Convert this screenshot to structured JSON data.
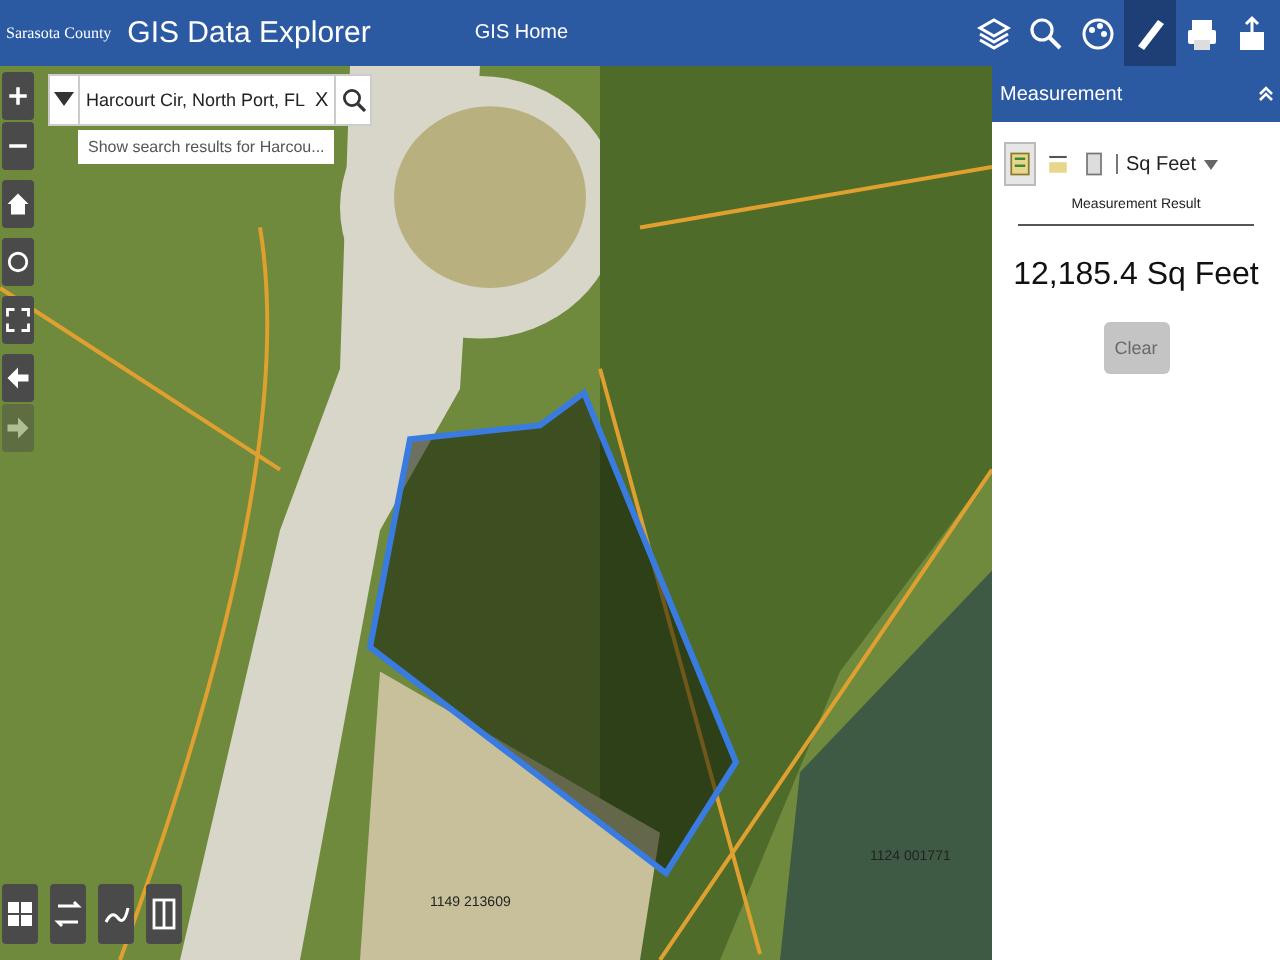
{
  "header": {
    "org": "Sarasota County",
    "title": "GIS Data Explorer",
    "nav_link": "GIS Home",
    "tools": [
      {
        "kind": "layers",
        "selected": false
      },
      {
        "kind": "search",
        "selected": false
      },
      {
        "kind": "palette",
        "selected": false
      },
      {
        "kind": "ruler",
        "selected": true
      },
      {
        "kind": "print",
        "selected": false
      },
      {
        "kind": "export",
        "selected": false
      }
    ]
  },
  "search": {
    "value": "Harcourt Cir, North Port, FL",
    "clear": "X",
    "suggestion": "Show search results for Harcou..."
  },
  "map_controls": [
    {
      "kind": "zoom-in",
      "disabled": false
    },
    {
      "kind": "zoom-out",
      "disabled": false
    },
    {
      "kind": "home",
      "disabled": false
    },
    {
      "kind": "locate",
      "disabled": false
    },
    {
      "kind": "fullscreen",
      "disabled": false
    },
    {
      "kind": "back",
      "disabled": false
    },
    {
      "kind": "forward",
      "disabled": true
    }
  ],
  "map": {
    "parcel_labels": [
      "1149 213609",
      "1124 001771"
    ]
  },
  "bottom_tools": [
    {
      "kind": "grid"
    },
    {
      "kind": "swap"
    },
    {
      "kind": "draw"
    },
    {
      "kind": "split"
    }
  ],
  "panel": {
    "title": "Measurement",
    "tools": [
      {
        "kind": "area",
        "selected": true
      },
      {
        "kind": "distance",
        "selected": false
      },
      {
        "kind": "location",
        "selected": false
      }
    ],
    "unit": "Sq Feet",
    "result_label": "Measurement Result",
    "result": "12,185.4 Sq Feet",
    "clear_button": {
      "label": "Clear",
      "disabled": true
    }
  }
}
